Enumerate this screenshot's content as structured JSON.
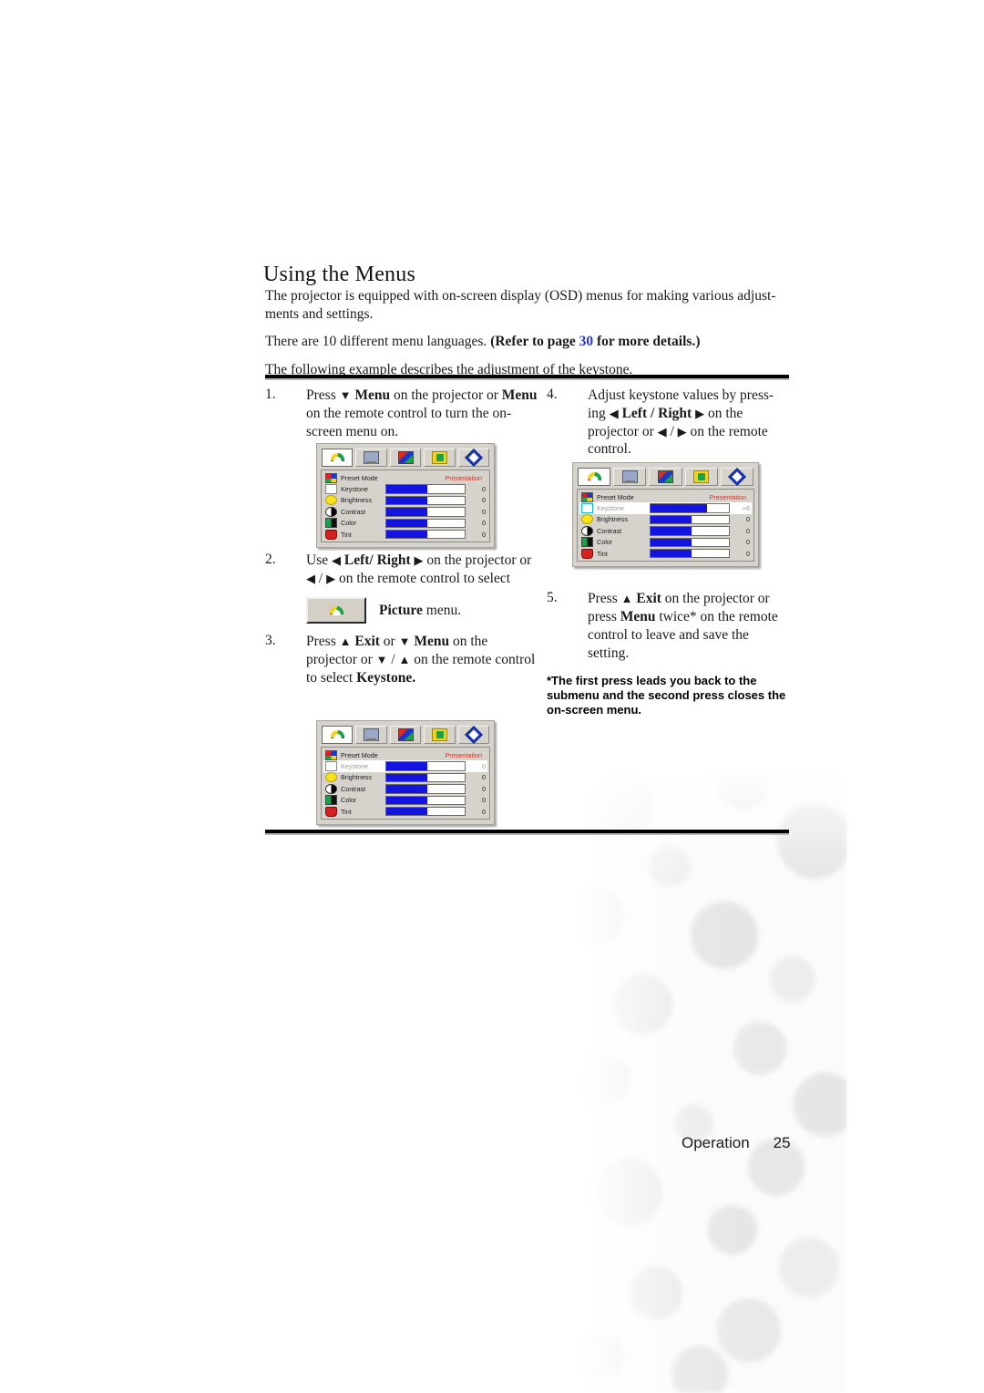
{
  "page": {
    "heading": "Using the Menus",
    "intro": [
      "The projector is equipped with on-screen display (OSD) menus for making various adjust-ments and settings.",
      "There are 10 different menu languages. (Refer to page 30 for more details.)",
      "The following example describes the adjustment of the keystone."
    ],
    "intro_line1": "The projector is equipped with on-screen display (OSD) menus for making various adjust-",
    "intro_line1b": "ments and settings.",
    "intro_line2_plain": "There are 10 different menu languages. ",
    "intro_line2_bold_a": "(Refer to page ",
    "intro_line2_link": "30",
    "intro_line2_bold_b": " for more details.)",
    "intro_line3": "The following example describes the adjustment of the keystone.",
    "link_color": "#2b35c8"
  },
  "steps": {
    "left": [
      {
        "number": "1.",
        "text_a": "Press ",
        "arrow_a": "▼",
        "text_b": " Menu",
        "text_c": " on the projector or ",
        "text_d": "Menu",
        "text_e": " on the remote control to turn the on-screen menu on."
      },
      {
        "number": "2.",
        "text_a": "Use ",
        "arrow_a": "◀",
        "text_b": " Left/ Right ",
        "arrow_b": "▶",
        "text_c": " on the projector or ",
        "arrow_c": "◀",
        "text_d": " / ",
        "arrow_d": "▶",
        "text_e": " on the remote control to select",
        "button_label_bold": "Picture",
        "button_label_rest": " menu."
      },
      {
        "number": "3.",
        "text_a": "Press ",
        "arrow_a": "▲",
        "text_b": " Exit",
        "text_c": " or ",
        "arrow_b": "▼",
        "text_d": " Menu",
        "text_e": " on the projector or ",
        "arrow_c": "▼",
        "text_f": " / ",
        "arrow_d": "▲",
        "text_g": " on the remote control to select ",
        "text_h": "Keystone."
      }
    ],
    "right": [
      {
        "number": "4.",
        "text_a": "Adjust keystone values by press-ing ",
        "arrow_a": "◀",
        "text_b": " Left / Right ",
        "arrow_b": "▶",
        "text_c": " on the projector or ",
        "arrow_c": "◀",
        "text_d": " / ",
        "arrow_d": "▶",
        "text_e": " on the remote control."
      },
      {
        "number": "5.",
        "text_a": "Press ",
        "arrow_a": "▲",
        "text_b": " Exit",
        "text_c": " on the projector or press ",
        "text_d": "Menu",
        "text_e": " twice* on the remote control to leave and save the setting."
      }
    ],
    "footnote": "*The first press leads you back to the submenu and the second press closes the on-screen menu."
  },
  "osd": {
    "tabs": [
      {
        "name": "picture-tab",
        "icon": "picture-icon"
      },
      {
        "name": "display-tab",
        "icon": "display-icon"
      },
      {
        "name": "source-tab",
        "icon": "source-icon"
      },
      {
        "name": "setup-tab",
        "icon": "setup-icon"
      },
      {
        "name": "information-tab",
        "icon": "info-diamond-icon"
      }
    ],
    "menu_a": {
      "preset_label": "Preset Mode",
      "preset_value": "Presentation",
      "rows": [
        {
          "label": "Keystone",
          "value": "0",
          "fill": 52,
          "highlight": false,
          "icon": "keystone-icon"
        },
        {
          "label": "Brightness",
          "value": "0",
          "fill": 52,
          "highlight": false,
          "icon": "brightness-icon"
        },
        {
          "label": "Contrast",
          "value": "0",
          "fill": 52,
          "highlight": false,
          "icon": "contrast-icon"
        },
        {
          "label": "Color",
          "value": "0",
          "fill": 52,
          "highlight": false,
          "icon": "color-icon"
        },
        {
          "label": "Tint",
          "value": "0",
          "fill": 52,
          "highlight": false,
          "icon": "tint-icon"
        }
      ]
    },
    "menu_b": {
      "preset_label": "Preset Mode",
      "preset_value": "Presentation",
      "rows": [
        {
          "label": "Keystone",
          "value": "+6",
          "fill": 72,
          "highlight": true,
          "icon": "keystone-icon"
        },
        {
          "label": "Brightness",
          "value": "0",
          "fill": 52,
          "highlight": false,
          "icon": "brightness-icon"
        },
        {
          "label": "Contrast",
          "value": "0",
          "fill": 52,
          "highlight": false,
          "icon": "contrast-icon"
        },
        {
          "label": "Color",
          "value": "0",
          "fill": 52,
          "highlight": false,
          "icon": "color-icon"
        },
        {
          "label": "Tint",
          "value": "0",
          "fill": 52,
          "highlight": false,
          "icon": "tint-icon"
        }
      ]
    },
    "menu_c": {
      "preset_label": "Preset Mode",
      "preset_value": "Presentation",
      "rows": [
        {
          "label": "Keystone",
          "value": "0",
          "fill": 52,
          "highlight": true,
          "icon": "keystone-icon"
        },
        {
          "label": "Brightness",
          "value": "0",
          "fill": 52,
          "highlight": false,
          "icon": "brightness-icon"
        },
        {
          "label": "Contrast",
          "value": "0",
          "fill": 52,
          "highlight": false,
          "icon": "contrast-icon"
        },
        {
          "label": "Color",
          "value": "0",
          "fill": 52,
          "highlight": false,
          "icon": "color-icon"
        },
        {
          "label": "Tint",
          "value": "0",
          "fill": 52,
          "highlight": false,
          "icon": "tint-icon"
        }
      ]
    },
    "colors": {
      "bar_fill": "#1414e0",
      "preset_value": "#c13a2a",
      "panel": "#d6d3cd"
    }
  },
  "footer": {
    "section": "Operation",
    "page_number": "25"
  }
}
